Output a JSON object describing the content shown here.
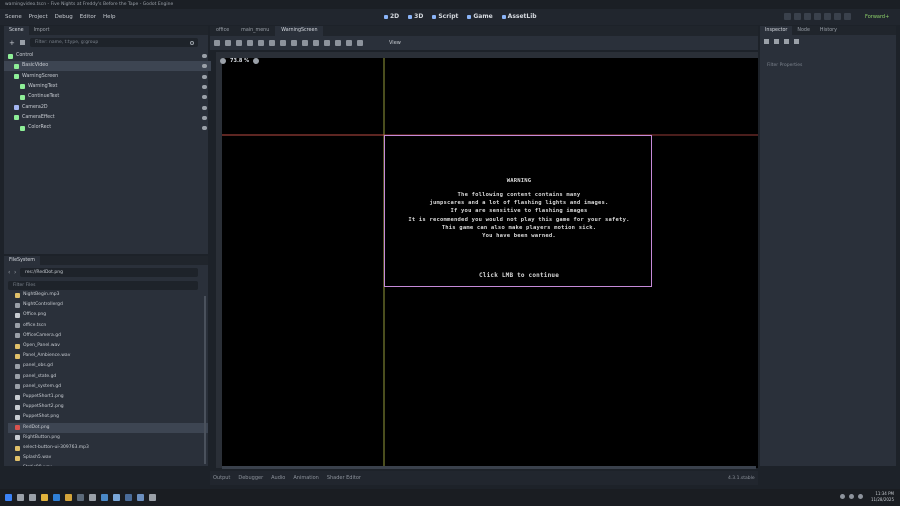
{
  "window": {
    "title": "warningvideo.tscn - Five Nights at Freddy's Before the Tape - Godot Engine"
  },
  "menu": {
    "items": [
      "Scene",
      "Project",
      "Debug",
      "Editor",
      "Help"
    ]
  },
  "workspaces": {
    "items": [
      "2D",
      "3D",
      "Script",
      "Game",
      "AssetLib"
    ]
  },
  "renderer": "Forward+",
  "scene_dock": {
    "tabs": [
      "Scene",
      "Import"
    ],
    "filter_placeholder": "Filter: name, t:type, g:group",
    "tree": [
      {
        "label": "Control",
        "depth": 0,
        "color": "#8eef97"
      },
      {
        "label": "BasicVideo",
        "depth": 1,
        "color": "#8eef97",
        "selected": true
      },
      {
        "label": "WarningScreen",
        "depth": 1,
        "color": "#8eef97"
      },
      {
        "label": "WarningText",
        "depth": 2,
        "color": "#8eef97"
      },
      {
        "label": "ContinueText",
        "depth": 2,
        "color": "#8eef97"
      },
      {
        "label": "Camera2D",
        "depth": 1,
        "color": "#a5b7f3"
      },
      {
        "label": "CameraEffect",
        "depth": 1,
        "color": "#8eef97"
      },
      {
        "label": "ColorRect",
        "depth": 2,
        "color": "#8eef97"
      }
    ]
  },
  "filesystem": {
    "tab": "FileSystem",
    "path": "res://RedDot.png",
    "filter_placeholder": "Filter Files",
    "files": [
      {
        "name": "NightBegin.mp3",
        "color": "#e0c06a"
      },
      {
        "name": "NightControllergd",
        "color": "#9aa0a8"
      },
      {
        "name": "Office.png",
        "color": "#c8ccd2"
      },
      {
        "name": "office.tscn",
        "color": "#9aa0a8"
      },
      {
        "name": "OfficeCamera.gd",
        "color": "#9aa0a8"
      },
      {
        "name": "Open_Panel.wav",
        "color": "#e0c06a"
      },
      {
        "name": "Panel_Ambience.wav",
        "color": "#e0c06a"
      },
      {
        "name": "panel_obs.gd",
        "color": "#9aa0a8"
      },
      {
        "name": "panel_state.gd",
        "color": "#9aa0a8"
      },
      {
        "name": "panel_system.gd",
        "color": "#9aa0a8"
      },
      {
        "name": "PuppetShort1.png",
        "color": "#c8ccd2"
      },
      {
        "name": "PuppetShort2.png",
        "color": "#c8ccd2"
      },
      {
        "name": "PuppetShot.png",
        "color": "#c8ccd2"
      },
      {
        "name": "RedDot.png",
        "color": "#d9534f",
        "selected": true
      },
      {
        "name": "RightButton.png",
        "color": "#c8ccd2"
      },
      {
        "name": "select-button-ui-309763.mp3",
        "color": "#e0c06a"
      },
      {
        "name": "Splash5.wav",
        "color": "#e0c06a"
      },
      {
        "name": "Static99.wav",
        "color": "#e0c06a"
      },
      {
        "name": "Vignette.png",
        "color": "#c8ccd2"
      }
    ]
  },
  "editor_tabs": [
    "office",
    "main_menu",
    "WarningScreen"
  ],
  "toolbar": {
    "view_label": "View"
  },
  "viewport": {
    "zoom": "73.8 %"
  },
  "warning": {
    "title": "WARNING",
    "lines": [
      "The following content contains many",
      "jumpscares and a lot of flashing lights and images.",
      "If you are sensitive to flashing images",
      "It is recommended you would not play this game for your safety.",
      "This game can also make players motion sick.",
      "You have been warned."
    ],
    "continue": "Click LMB to continue"
  },
  "bottom_tabs": [
    "Output",
    "Debugger",
    "Audio",
    "Animation",
    "Shader Editor"
  ],
  "version": "4.3.1.stable",
  "inspector": {
    "tabs": [
      "Inspector",
      "Node",
      "History"
    ],
    "filter_placeholder": "Filter Properties"
  },
  "clock": {
    "time": "11:34 PM",
    "date": "11/28/2025"
  }
}
